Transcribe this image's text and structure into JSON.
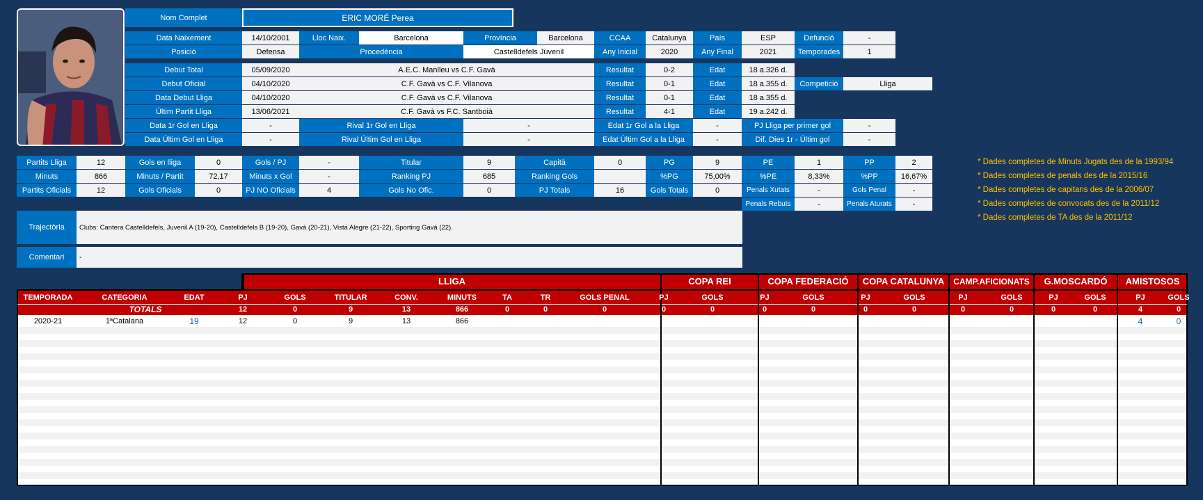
{
  "player": {
    "full_name_label": "Nom Complet",
    "full_name": "ERIC MORÉ Perea",
    "birth_date_label": "Data Naixement",
    "birth_date": "14/10/2001",
    "birth_place_label": "Lloc Naix.",
    "birth_place": "Barcelona",
    "province_label": "Província",
    "province": "Barcelona",
    "ccaa_label": "CCAA",
    "ccaa": "Catalunya",
    "country_label": "País",
    "country": "ESP",
    "death_label": "Defunció",
    "death": "-",
    "position_label": "Posició",
    "position": "Defensa",
    "origin_label": "Procedència",
    "origin": "Castelldefels Juvenil",
    "start_year_label": "Any Inicial",
    "start_year": "2020",
    "end_year_label": "Any Final",
    "end_year": "2021",
    "seasons_label": "Temporades",
    "seasons": "1"
  },
  "debuts": [
    {
      "label": "Debut Total",
      "date": "05/09/2020",
      "match": "A.E.C. Manlleu vs C.F. Gavà",
      "result_label": "Resultat",
      "result": "0-2",
      "age_label": "Edat",
      "age": "18 a.326 d."
    },
    {
      "label": "Debut Oficial",
      "date": "04/10/2020",
      "match": "C.F. Gavà vs C.F. Vilanova",
      "result_label": "Resultat",
      "result": "0-1",
      "age_label": "Edat",
      "age": "18 a.355 d."
    },
    {
      "label": "Data Debut Lliga",
      "date": "04/10/2020",
      "match": "C.F. Gavà vs C.F. Vilanova",
      "result_label": "Resultat",
      "result": "0-1",
      "age_label": "Edat",
      "age": "18 a.355 d."
    },
    {
      "label": "Últim Partit Lliga",
      "date": "13/06/2021",
      "match": "C.F. Gavà vs F.C. Santboià",
      "result_label": "Resultat",
      "result": "4-1",
      "age_label": "Edat",
      "age": "19 a.242 d."
    }
  ],
  "competition_label": "Competició",
  "competition": "Lliga",
  "goals_info": [
    {
      "label": "Data 1r Gol en Lliga",
      "value": "-",
      "rival_label": "Rival 1r Gol en Lliga",
      "rival": "-",
      "age_label": "Edat 1r Gol a la Lliga",
      "age": "-",
      "extra_label": "PJ Lliga per primer gol",
      "extra": "-"
    },
    {
      "label": "Data Últim Gol en Lliga",
      "value": "-",
      "rival_label": "Rival Últim Gol en Lliga",
      "rival": "-",
      "age_label": "Edat Últim Gol a la Lliga",
      "age": "-",
      "extra_label": "Dif. Dies 1r - Últim gol",
      "extra": "-"
    }
  ],
  "stats": {
    "partits_lliga_label": "Partits Lliga",
    "partits_lliga": "12",
    "gols_lliga_label": "Gols en lliga",
    "gols_lliga": "0",
    "gols_pj_label": "Gols / PJ",
    "gols_pj": "-",
    "titular_label": "Titular",
    "titular": "9",
    "capita_label": "Capità",
    "capita": "0",
    "pg_label": "PG",
    "pg": "9",
    "pe_label": "PE",
    "pe": "1",
    "pp_label": "PP",
    "pp": "2",
    "minuts_label": "Minuts",
    "minuts": "866",
    "min_partit_label": "Minuts / Partit",
    "min_partit": "72,17",
    "min_gol_label": "Minuts x Gol",
    "min_gol": "-",
    "ranking_pj_label": "Ranking PJ",
    "ranking_pj": "685",
    "ranking_gols_label": "Ranking Gols",
    "ranking_gols": "",
    "pct_pg_label": "%PG",
    "pct_pg": "75,00%",
    "pct_pe_label": "%PE",
    "pct_pe": "8,33%",
    "pct_pp_label": "%PP",
    "pct_pp": "16,67%",
    "partits_oficials_label": "Partits Oficials",
    "partits_oficials": "12",
    "gols_oficials_label": "Gols Oficials",
    "gols_oficials": "0",
    "pj_no_oficials_label": "PJ NO Oficials",
    "pj_no_oficials": "4",
    "gols_no_ofic_label": "Gols No Ofic.",
    "gols_no_ofic": "0",
    "pj_totals_label": "PJ Totals",
    "pj_totals": "16",
    "gols_totals_label": "Gols Totals",
    "gols_totals": "0",
    "penals_xutats_label": "Penals Xutats",
    "penals_xutats": "-",
    "gols_penal_label": "Gols Penal",
    "gols_penal": "-",
    "penals_rebuts_label": "Penals Rebuts",
    "penals_rebuts": "-",
    "penals_aturats_label": "Penals Aturats",
    "penals_aturats": "-"
  },
  "notes": [
    "* Dades completes de Minuts Jugats des de la 1993/94",
    "* Dades completes de penals des de la 2015/16",
    "* Dades completes de capitans des de la 2006/07",
    "* Dades completes de convocats des de la 2011/12",
    "* Dades completes de TA des de la 2011/12"
  ],
  "trajectoria_label": "Trajectòria",
  "trajectoria": "Clubs: Cantera Castelldefels, Juvenil A (19-20), Castelldefels B (19-20), Gavà (20-21), Vista Alegre (21-22), Sporting Gavà (22).",
  "comentari_label": "Comentari",
  "comentari": "-",
  "table": {
    "groups": [
      "LLIGA",
      "COPA REI",
      "COPA FEDERACIÓ",
      "COPA CATALUNYA",
      "CAMP.AFICIONATS",
      "G.MOSCARDÓ",
      "AMISTOSOS"
    ],
    "columns": [
      "TEMPORADA",
      "CATEGORIA",
      "EDAT",
      "PJ",
      "GOLS",
      "TITULAR",
      "CONV.",
      "MINUTS",
      "TA",
      "TR",
      "GOLS PENAL",
      "PJ",
      "GOLS",
      "PJ",
      "GOLS",
      "PJ",
      "GOLS",
      "PJ",
      "GOLS",
      "PJ",
      "GOLS",
      "PJ",
      "GOLS"
    ],
    "totals_label": "TOTALS",
    "totals": [
      "",
      "",
      "",
      "12",
      "0",
      "9",
      "13",
      "866",
      "0",
      "0",
      "0",
      "0",
      "0",
      "0",
      "0",
      "0",
      "0",
      "0",
      "0",
      "0",
      "0",
      "4",
      "0"
    ],
    "rows": [
      [
        "2020-21",
        "1ªCatalana",
        "19",
        "12",
        "0",
        "9",
        "13",
        "866",
        "",
        "",
        "",
        "",
        "",
        "",
        "",
        "",
        "",
        "",
        "",
        "",
        "",
        "4",
        "0"
      ]
    ]
  }
}
